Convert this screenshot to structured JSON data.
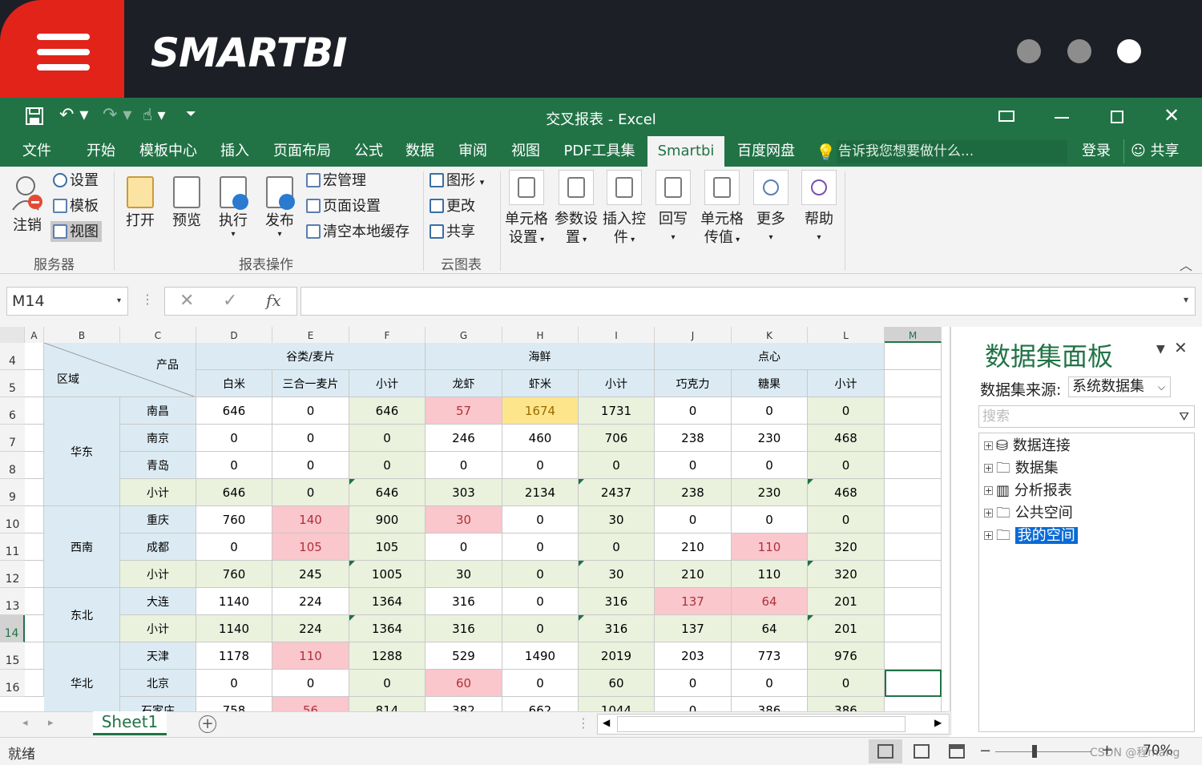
{
  "brand": {
    "logo": "SMARTBI"
  },
  "window": {
    "title": "交叉报表 - Excel"
  },
  "menu_tabs": [
    "文件",
    "开始",
    "模板中心",
    "插入",
    "页面布局",
    "公式",
    "数据",
    "审阅",
    "视图",
    "PDF工具集",
    "Smartbi",
    "百度网盘"
  ],
  "tell_me": "告诉我您想要做什么...",
  "account": {
    "login": "登录",
    "share": "共享"
  },
  "ribbon": {
    "server": {
      "logout": "注销",
      "settings": "设置",
      "template": "模板",
      "view": "视图",
      "label": "服务器"
    },
    "report": {
      "open": "打开",
      "preview": "预览",
      "execute": "执行",
      "publish": "发布",
      "macro": "宏管理",
      "page_setup": "页面设置",
      "clear_cache": "清空本地缓存",
      "label": "报表操作"
    },
    "cloud": {
      "chart": "图形",
      "change": "更改",
      "share": "共享",
      "label": "云图表"
    },
    "extra": {
      "cell_settings_1": "单元格",
      "cell_settings_2": "设置",
      "param_1": "参数设",
      "param_2": "置",
      "insert_ctrl_1": "插入控",
      "insert_ctrl_2": "件",
      "writeback": "回写",
      "cell_pass_1": "单元格",
      "cell_pass_2": "传值",
      "more": "更多",
      "help": "帮助"
    }
  },
  "formula": {
    "name_box": "M14",
    "fx": "fx",
    "value": ""
  },
  "columns": [
    "A",
    "B",
    "C",
    "D",
    "E",
    "F",
    "G",
    "H",
    "I",
    "J",
    "K",
    "L",
    "M"
  ],
  "row_numbers": [
    "4",
    "5",
    "6",
    "7",
    "8",
    "9",
    "10",
    "11",
    "12",
    "13",
    "14",
    "15",
    "16"
  ],
  "header": {
    "corner_top": "产品",
    "corner_bottom": "区域",
    "groups": [
      "谷类/麦片",
      "海鲜",
      "点心"
    ],
    "products": [
      "白米",
      "三合一麦片",
      "小计",
      "龙虾",
      "虾米",
      "小计",
      "巧克力",
      "糖果",
      "小计"
    ]
  },
  "regions": [
    {
      "name": "华东",
      "rows": [
        {
          "city": "南昌",
          "values": [
            "646",
            "0",
            "646",
            "57",
            "1674",
            "1731",
            "0",
            "0",
            "0"
          ]
        },
        {
          "city": "南京",
          "values": [
            "0",
            "0",
            "0",
            "246",
            "460",
            "706",
            "238",
            "230",
            "468"
          ]
        },
        {
          "city": "青岛",
          "values": [
            "0",
            "0",
            "0",
            "0",
            "0",
            "0",
            "0",
            "0",
            "0"
          ]
        },
        {
          "city": "小计",
          "values": [
            "646",
            "0",
            "646",
            "303",
            "2134",
            "2437",
            "238",
            "230",
            "468"
          ]
        }
      ]
    },
    {
      "name": "西南",
      "rows": [
        {
          "city": "重庆",
          "values": [
            "760",
            "140",
            "900",
            "30",
            "0",
            "30",
            "0",
            "0",
            "0"
          ]
        },
        {
          "city": "成都",
          "values": [
            "0",
            "105",
            "105",
            "0",
            "0",
            "0",
            "210",
            "110",
            "320"
          ]
        },
        {
          "city": "小计",
          "values": [
            "760",
            "245",
            "1005",
            "30",
            "0",
            "30",
            "210",
            "110",
            "320"
          ]
        }
      ]
    },
    {
      "name": "东北",
      "rows": [
        {
          "city": "大连",
          "values": [
            "1140",
            "224",
            "1364",
            "316",
            "0",
            "316",
            "137",
            "64",
            "201"
          ]
        },
        {
          "city": "小计",
          "values": [
            "1140",
            "224",
            "1364",
            "316",
            "0",
            "316",
            "137",
            "64",
            "201"
          ]
        }
      ]
    },
    {
      "name": "华北",
      "rows": [
        {
          "city": "天津",
          "values": [
            "1178",
            "110",
            "1288",
            "529",
            "1490",
            "2019",
            "203",
            "773",
            "976"
          ]
        },
        {
          "city": "北京",
          "values": [
            "0",
            "0",
            "0",
            "60",
            "0",
            "60",
            "0",
            "0",
            "0"
          ]
        },
        {
          "city": "石家庄",
          "values": [
            "758",
            "56",
            "814",
            "382",
            "662",
            "1044",
            "0",
            "386",
            "386"
          ]
        }
      ]
    }
  ],
  "colors": {
    "highlight_red": "#f9c7cc",
    "highlight_yellow": "#fde58c",
    "header_blue": "#dcebf3",
    "subtotal_green": "#eaf1dd",
    "excel_green": "#217346"
  },
  "panel": {
    "title": "数据集面板",
    "source_label": "数据集来源:",
    "source_value": "系统数据集",
    "search_placeholder": "搜索",
    "tree": [
      "数据连接",
      "数据集",
      "分析报表",
      "公共空间",
      "我的空间"
    ]
  },
  "sheet_tab": "Sheet1",
  "status": {
    "ready": "就绪",
    "zoom": "70%",
    "watermark": "CSDN @程mang"
  }
}
